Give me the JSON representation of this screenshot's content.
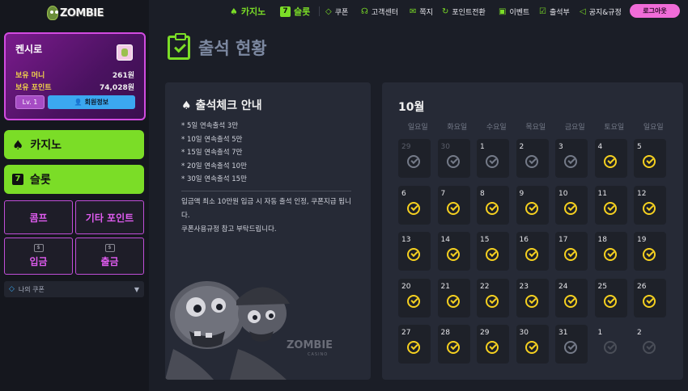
{
  "brand": {
    "name": "ZOMBIE",
    "sub": "CASINO"
  },
  "user": {
    "name": "켄시로",
    "money_label": "보유 머니",
    "money_value": "261원",
    "point_label": "보유 포인트",
    "point_value": "74,028원",
    "level": "Lv. 1",
    "info_button": "회원정보"
  },
  "sidebar": {
    "casino": "카지노",
    "slot": "슬롯",
    "comp": "콤프",
    "other_point": "기타 포인트",
    "deposit": "입금",
    "withdraw": "출금",
    "coupon": "나의 쿠폰"
  },
  "nav": {
    "casino": "카지노",
    "slot": "슬롯",
    "coupon": "쿠폰",
    "support": "고객센터",
    "message": "쪽지",
    "point_convert": "포인트전환",
    "event": "이벤트",
    "attendance": "출석부",
    "notice": "공지&규정",
    "logout": "로그아웃"
  },
  "page": {
    "title": "출석 현황"
  },
  "guide": {
    "title": "출석체크 안내",
    "rules": [
      "* 5일 연속출석 3만",
      "* 10일 연속출석 5만",
      "* 15일 연속출석 7만",
      "* 20일 연속출석 10만",
      "* 30일 연속출석 15만"
    ],
    "notice": "입금액 최소 10만원 입금 시 자동 출석 인정, 쿠폰지급 됩니다.",
    "notice2": "쿠폰사용규정 참고 부탁드립니다."
  },
  "calendar": {
    "month": "10월",
    "weekdays": [
      "일요일",
      "화요일",
      "수요일",
      "목요일",
      "금요일",
      "토요일",
      "일요일"
    ],
    "days": [
      {
        "d": "29",
        "s": "dim"
      },
      {
        "d": "30",
        "s": "dim"
      },
      {
        "d": "1",
        "s": "gray"
      },
      {
        "d": "2",
        "s": "gray"
      },
      {
        "d": "3",
        "s": "gray"
      },
      {
        "d": "4",
        "s": "on"
      },
      {
        "d": "5",
        "s": "on"
      },
      {
        "d": "6",
        "s": "on"
      },
      {
        "d": "7",
        "s": "on"
      },
      {
        "d": "8",
        "s": "on"
      },
      {
        "d": "9",
        "s": "on"
      },
      {
        "d": "10",
        "s": "on"
      },
      {
        "d": "11",
        "s": "on"
      },
      {
        "d": "12",
        "s": "on"
      },
      {
        "d": "13",
        "s": "on"
      },
      {
        "d": "14",
        "s": "on"
      },
      {
        "d": "15",
        "s": "on"
      },
      {
        "d": "16",
        "s": "on"
      },
      {
        "d": "17",
        "s": "on"
      },
      {
        "d": "18",
        "s": "on"
      },
      {
        "d": "19",
        "s": "on"
      },
      {
        "d": "20",
        "s": "on"
      },
      {
        "d": "21",
        "s": "on"
      },
      {
        "d": "22",
        "s": "on"
      },
      {
        "d": "23",
        "s": "on"
      },
      {
        "d": "24",
        "s": "on"
      },
      {
        "d": "25",
        "s": "on"
      },
      {
        "d": "26",
        "s": "on"
      },
      {
        "d": "27",
        "s": "on"
      },
      {
        "d": "28",
        "s": "on"
      },
      {
        "d": "29",
        "s": "on"
      },
      {
        "d": "30",
        "s": "on"
      },
      {
        "d": "31",
        "s": "gray"
      },
      {
        "d": "1",
        "s": "out"
      },
      {
        "d": "2",
        "s": "out"
      }
    ]
  }
}
